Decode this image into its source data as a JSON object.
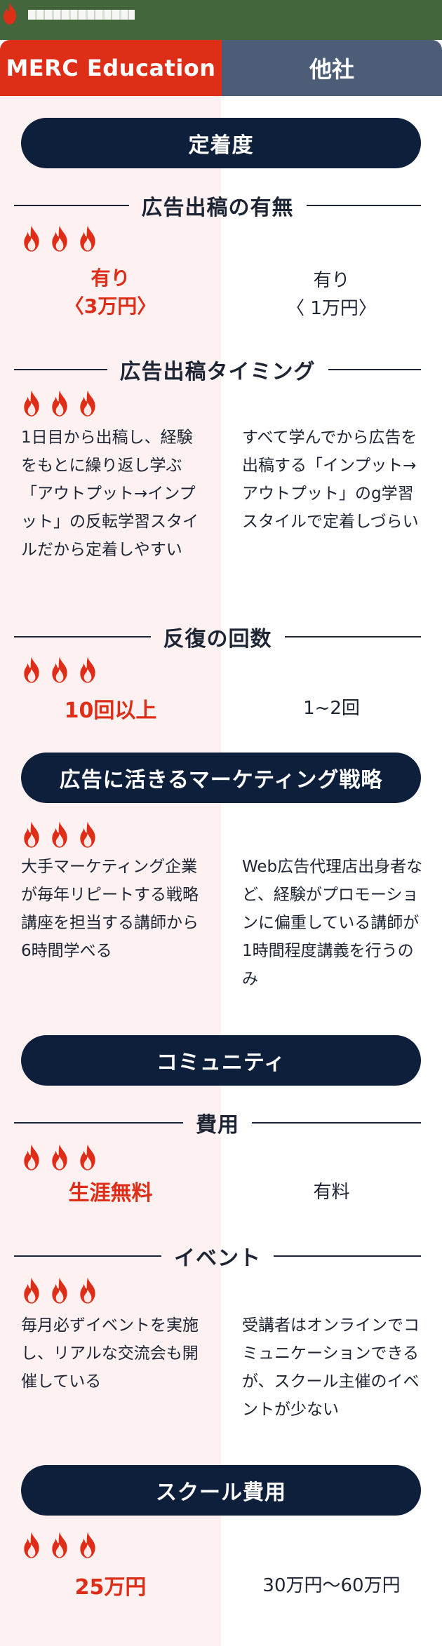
{
  "tabs": {
    "left": "MERC Education",
    "right": "他社"
  },
  "sections": {
    "teichaku": "定着度",
    "senryaku": "広告に活きるマーケティング戦略",
    "community": "コミュニティ",
    "hiyou": "スクール費用"
  },
  "items": {
    "ad_presence": {
      "title": "広告出稿の有無",
      "left": "有り\n〈3万円〉",
      "right": "有り\n〈 1万円〉"
    },
    "ad_timing": {
      "title": "広告出稿タイミング",
      "left": "1日目から出稿し、経験をもとに繰り返し学ぶ「アウトプット→インプット」の反転学習スタイルだから定着しやすい",
      "right": "すべて学んでから広告を出稿する「インプット→アウトプット」のg学習スタイルで定着しづらい"
    },
    "repeat": {
      "title": "反復の回数",
      "left": "10回以上",
      "right": "1~2回"
    },
    "strategy": {
      "left": "大手マーケティング企業が毎年リピートする戦略講座を担当する講師から6時間学べる",
      "right": "Web広告代理店出身者など、経験がプロモーションに偏重している講師が1時間程度講義を行うのみ"
    },
    "cost": {
      "title": "費用",
      "left": "生涯無料",
      "right": "有料"
    },
    "event": {
      "title": "イベント",
      "left": "毎月必ずイベントを実施し、リアルな交流会も開催している",
      "right": "受講者はオンラインでコミュニケーションできるが、スクール主催のイベントが少ない"
    },
    "school_fee": {
      "left": "25万円",
      "right": "30万円〜60万円"
    }
  },
  "rating": {
    "icon": "flame-icon",
    "count": 3,
    "color": "#df2e17"
  },
  "colors": {
    "accent": "#df2e17",
    "navy": "#0e1f3b",
    "slate": "#4d5c77",
    "topbar": "#43663d"
  }
}
